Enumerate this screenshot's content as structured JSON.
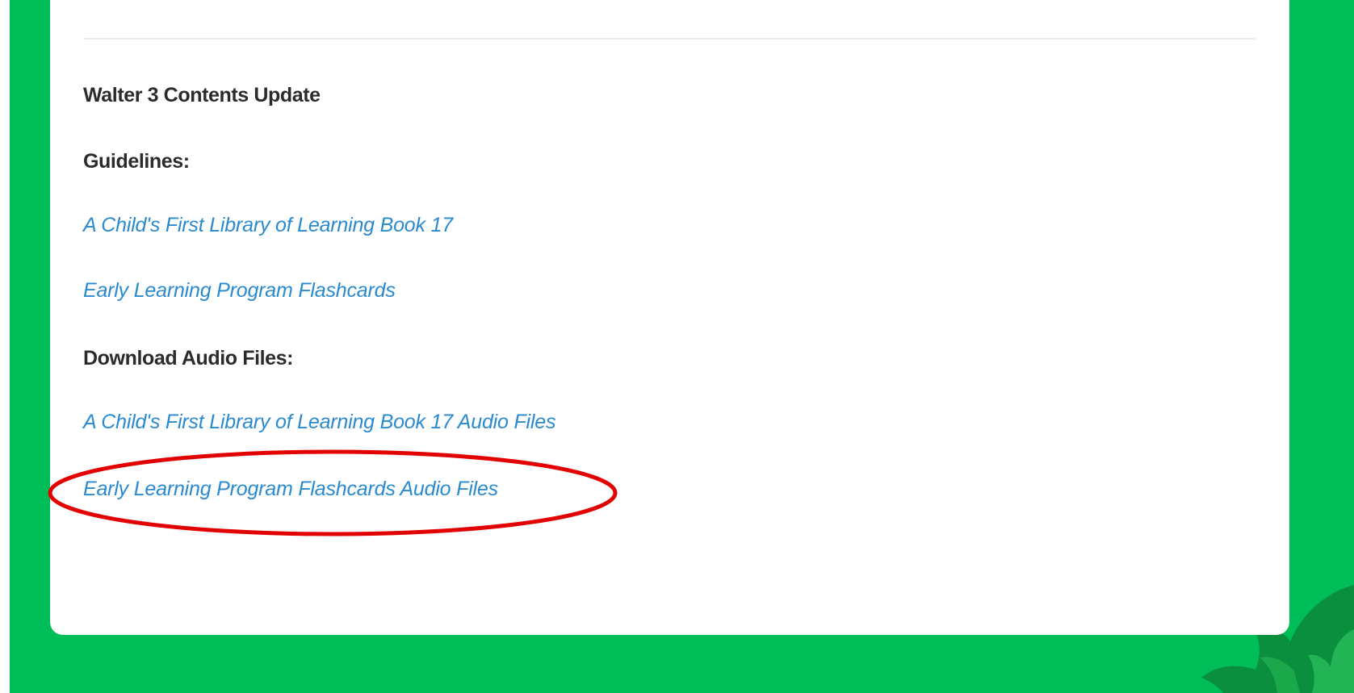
{
  "content": {
    "title": "Walter 3  Contents Update",
    "guidelines": {
      "heading": "Guidelines:",
      "links": [
        "A Child's First Library of Learning Book 17",
        "Early Learning Program Flashcards"
      ]
    },
    "downloads": {
      "heading": "Download Audio Files:",
      "links": [
        "A Child's First Library of Learning Book 17 Audio Files",
        "Early Learning Program Flashcards Audio Files"
      ]
    }
  },
  "colors": {
    "page_background": "#00be57",
    "card_background": "#ffffff",
    "heading_text": "#2b2b2b",
    "link_text": "#2a8ad0",
    "highlight_oval": "#e30000",
    "bush_dark": "#0a8f3e",
    "bush_light": "#22b455"
  },
  "decorations": {
    "highlight": "red-oval-around-flashcards-audio-files-link",
    "corner_graphic": "leaf-bush-icon"
  }
}
